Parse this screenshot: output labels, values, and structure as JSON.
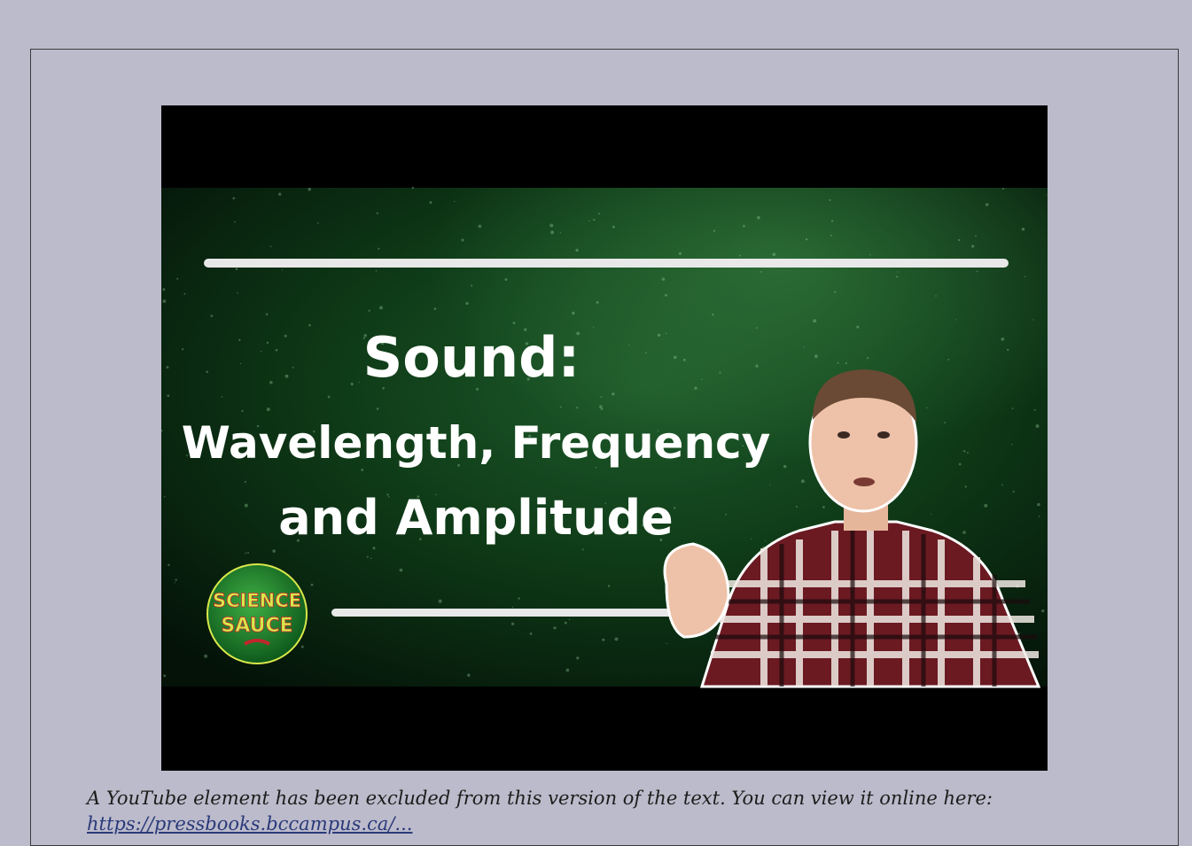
{
  "video": {
    "title_line1": "Sound:",
    "title_line2": "Wavelength, Frequency",
    "title_line3": "and Amplitude",
    "logo_line1": "SCIENCE",
    "logo_line2": "SAUCE"
  },
  "notice": {
    "text": "A YouTube element has been excluded from this version of the text. You can view it online here:",
    "link_text": "https://pressbooks.bccampus.ca/..."
  },
  "colors": {
    "page_background": "#bcbbcb",
    "video_background": "#000000",
    "thumbnail_green": "#0f4a1c",
    "logo_green": "#1d7a2e",
    "logo_red": "#c0272d"
  }
}
